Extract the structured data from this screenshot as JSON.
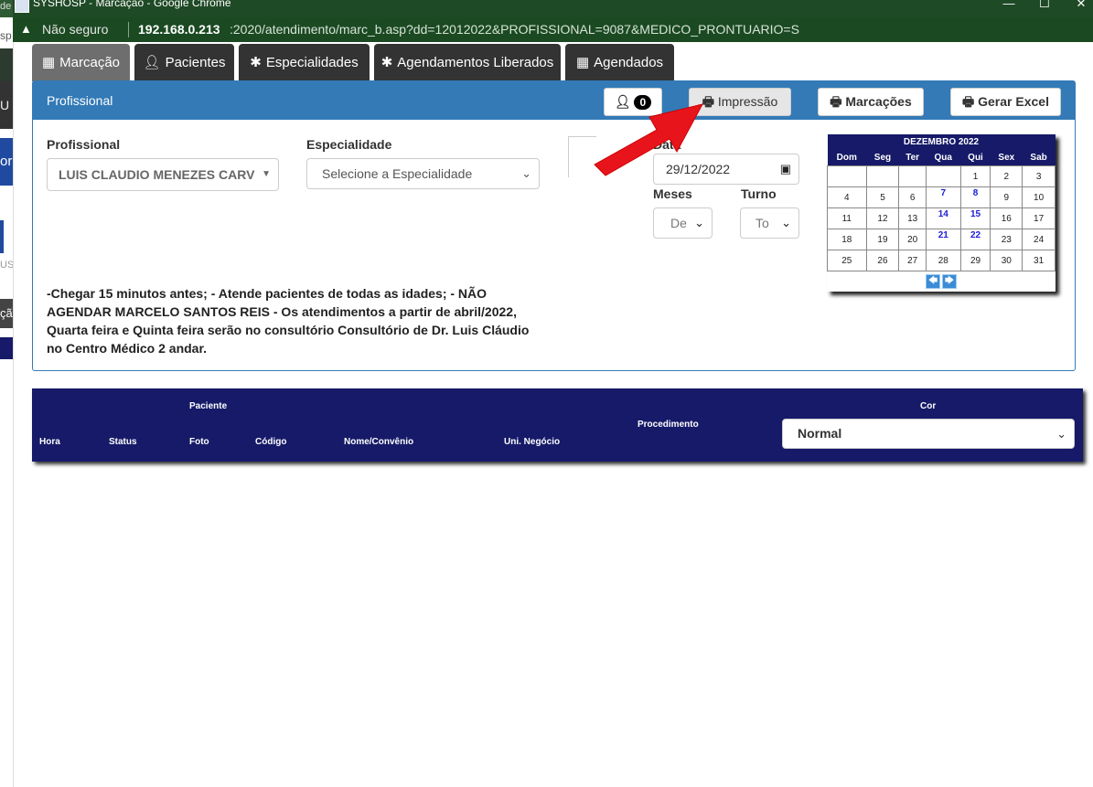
{
  "window": {
    "title": "SYSHOSP - Marcação - Google Chrome",
    "left_fragment": "de",
    "controls": {
      "minimize": "—",
      "maximize": "☐",
      "close": "✕"
    }
  },
  "address_bar": {
    "security_icon": "warning-icon",
    "security_text": "Não seguro",
    "host": "192.168.0.213",
    "path": ":2020/atendimento/marc_b.asp?dd=12012022&PROFISSIONAL=9087&MEDICO_PRONTUARIO=S"
  },
  "left_strip": {
    "frag1": "sp",
    "frag2": "U",
    "frag3": "or",
    "frag4": "US",
    "frag5": "çã"
  },
  "tabs": [
    {
      "label": "Marcação",
      "icon": "calendar-icon"
    },
    {
      "label": "Pacientes",
      "icon": "user-icon"
    },
    {
      "label": "Especialidades",
      "icon": "asterisk-icon"
    },
    {
      "label": "Agendamentos Liberados",
      "icon": "asterisk-icon"
    },
    {
      "label": "Agendados",
      "icon": "calendar-icon"
    }
  ],
  "panel": {
    "title": "Profissional",
    "buttons": {
      "count_badge": "0",
      "impressao": "Impressão",
      "marcacoes": "Marcações",
      "gerar_excel": "Gerar Excel"
    },
    "profissional_label": "Profissional",
    "profissional_value": "LUIS CLAUDIO MENEZES CARV",
    "especialidade_label": "Especialidade",
    "especialidade_placeholder": "Selecione a Especialidade",
    "data_label": "Data",
    "data_value": "29/12/2022",
    "meses_label": "Meses",
    "meses_value": "De",
    "turno_label": "Turno",
    "turno_value": "To",
    "note": "-Chegar 15 minutos antes; - Atende pacientes de todas as idades; - NÃO AGENDAR MARCELO SANTOS REIS - Os atendimentos a partir de abril/2022, Quarta feira e Quinta feira serão no consultório Consultório de Dr. Luis Cláudio no Centro Médico 2 andar."
  },
  "calendar": {
    "month": "DEZEMBRO 2022",
    "weekdays": [
      "Dom",
      "Seg",
      "Ter",
      "Qua",
      "Qui",
      "Sex",
      "Sab"
    ],
    "weeks": [
      [
        "",
        "",
        "",
        "",
        "1",
        "2",
        "3"
      ],
      [
        "4",
        "5",
        "6",
        "7",
        "8",
        "9",
        "10"
      ],
      [
        "11",
        "12",
        "13",
        "14",
        "15",
        "16",
        "17"
      ],
      [
        "18",
        "19",
        "20",
        "21",
        "22",
        "23",
        "24"
      ],
      [
        "25",
        "26",
        "27",
        "28",
        "29",
        "30",
        "31"
      ]
    ],
    "highlighted_days": [
      "7",
      "8",
      "14",
      "15",
      "21",
      "22"
    ],
    "prev": "🡄",
    "next": "🡆"
  },
  "grid": {
    "paciente_group": "Paciente",
    "cor_group": "Cor",
    "columns": {
      "hora": "Hora",
      "status": "Status",
      "foto": "Foto",
      "codigo": "Código",
      "nome": "Nome/Convênio",
      "uni": "Uni. Negócio",
      "procedimento": "Procedimento"
    },
    "cor_value": "Normal"
  },
  "colors": {
    "panel_blue": "#337ab7",
    "navy": "#161a68",
    "chrome_green": "#1f4a26",
    "arrow_red": "#e8141c"
  }
}
